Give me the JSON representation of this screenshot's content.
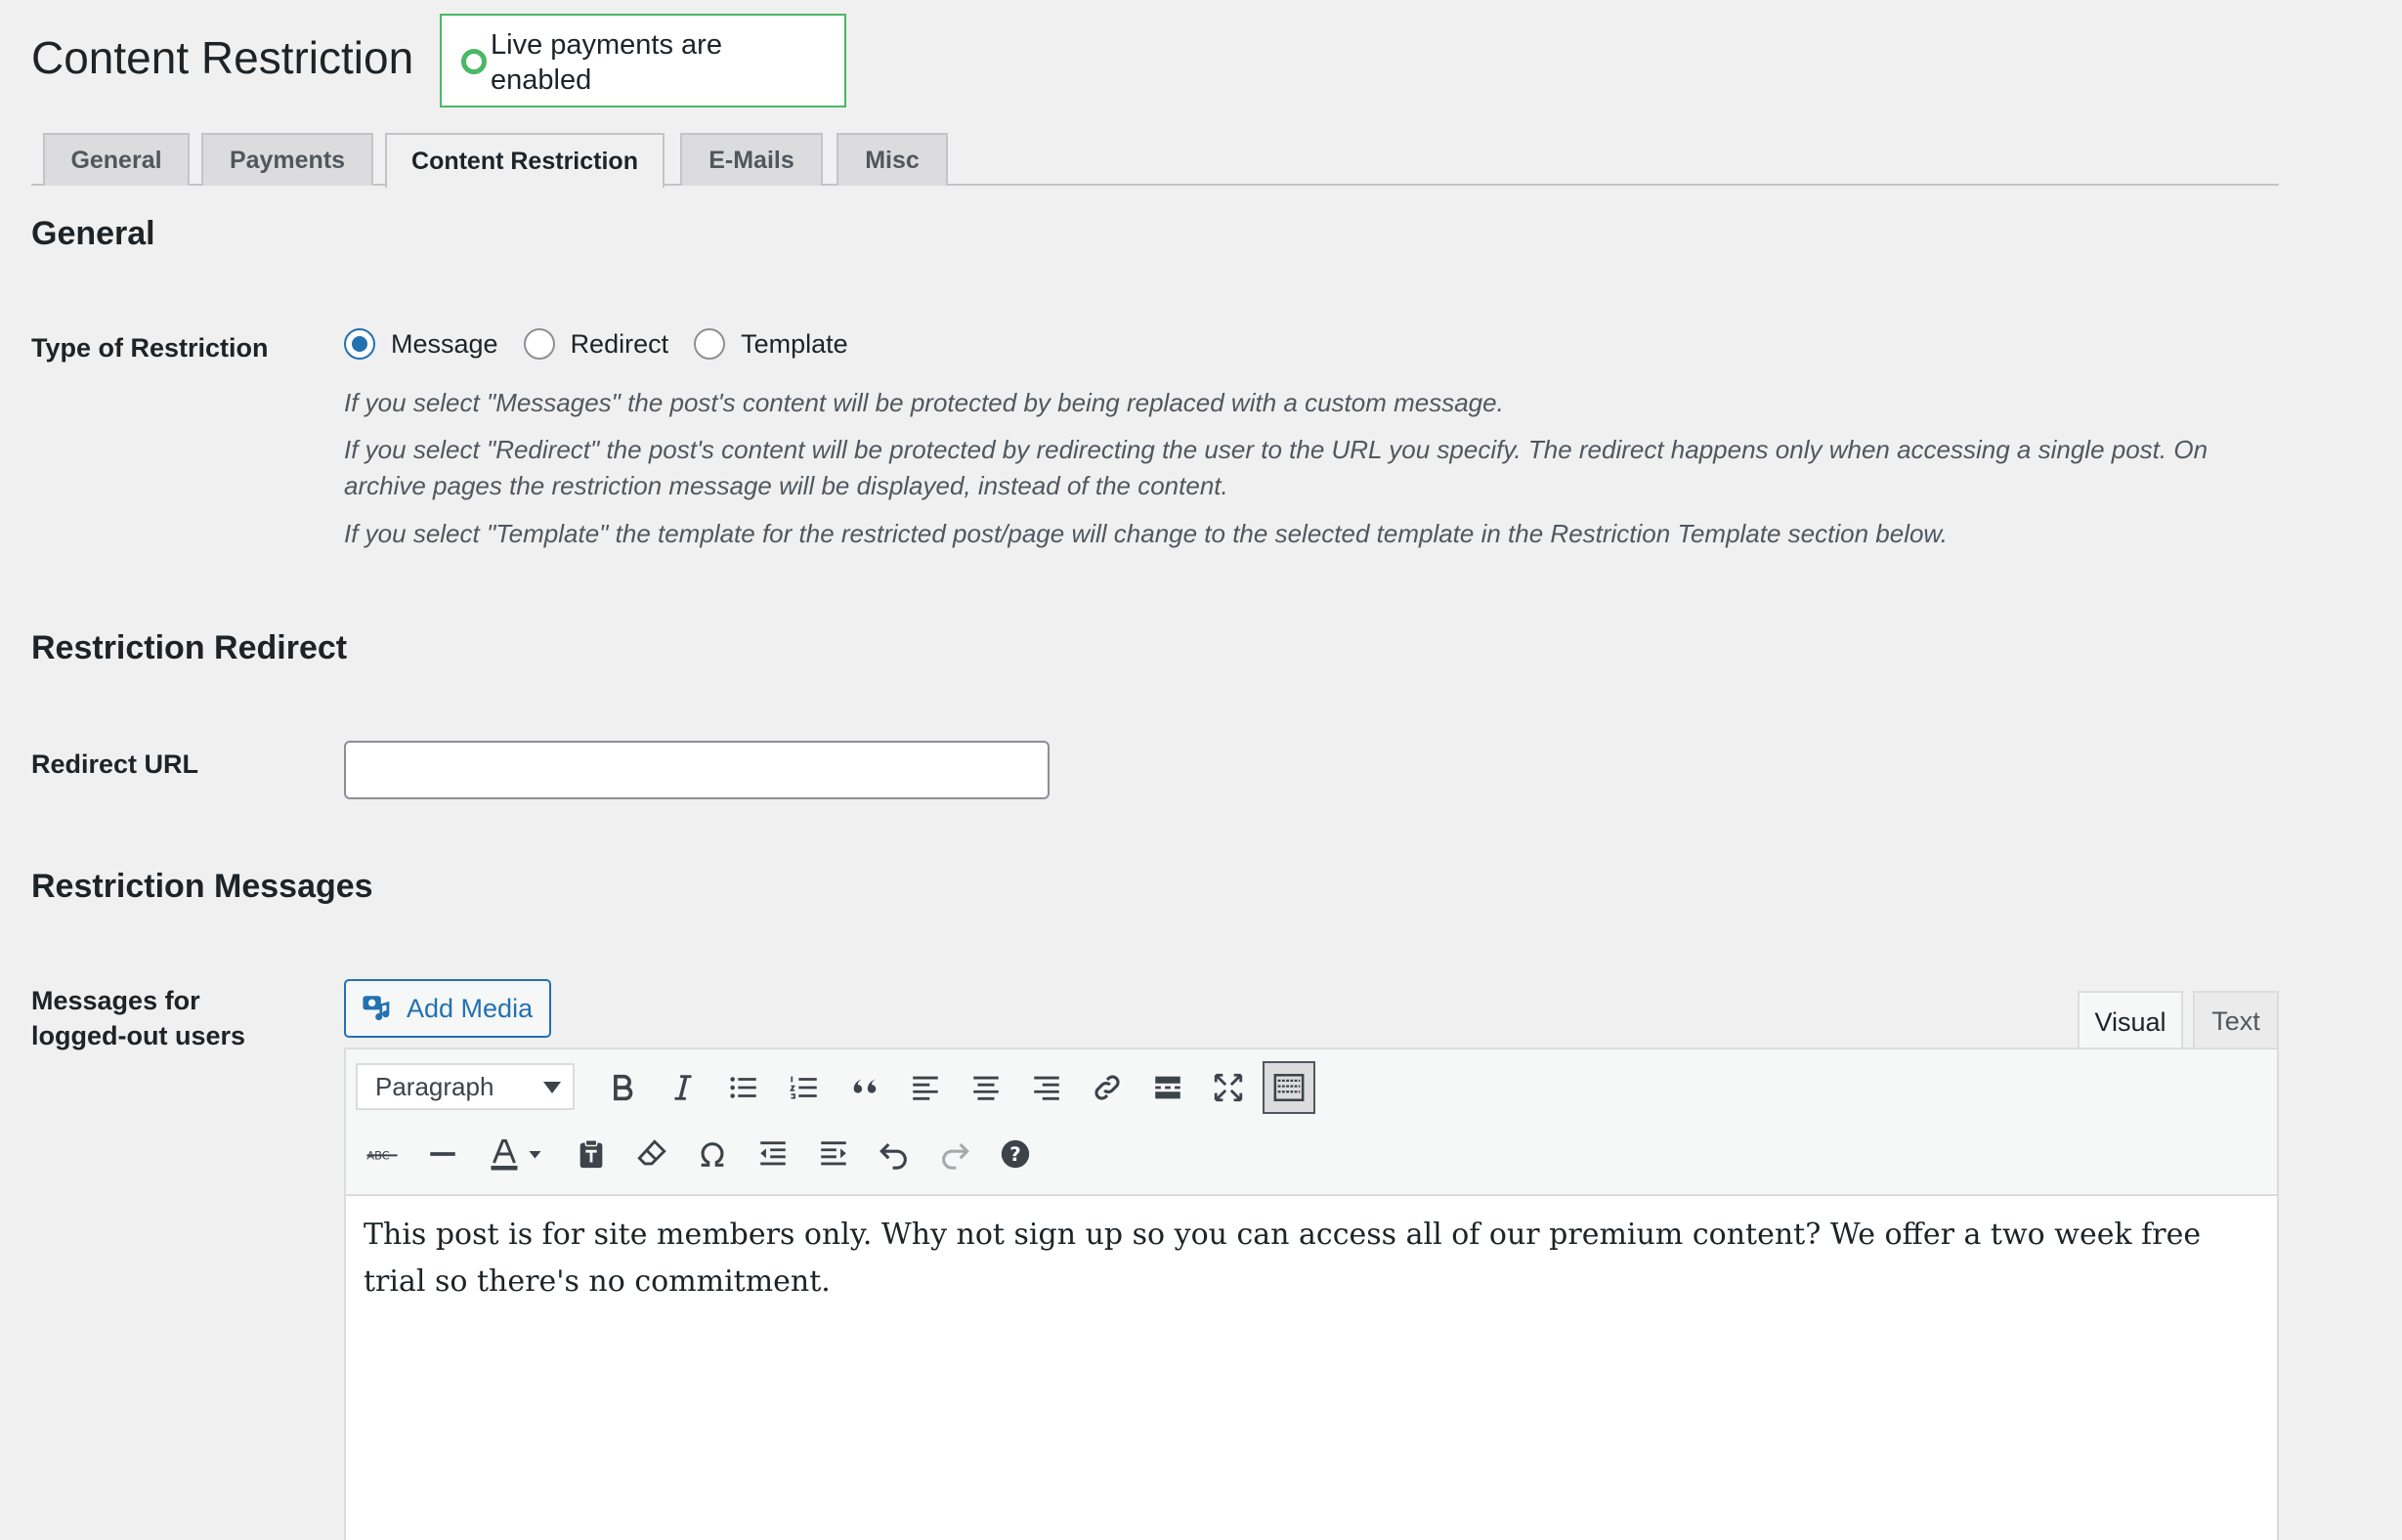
{
  "header": {
    "title": "Content Restriction",
    "notice": "Live payments are enabled",
    "notice_color": "#4ab866"
  },
  "tabs": [
    {
      "label": "General",
      "active": false
    },
    {
      "label": "Payments",
      "active": false
    },
    {
      "label": "Content Restriction",
      "active": true
    },
    {
      "label": "E-Mails",
      "active": false
    },
    {
      "label": "Misc",
      "active": false
    }
  ],
  "general": {
    "heading": "General",
    "type_label": "Type of Restriction",
    "options": [
      {
        "label": "Message",
        "checked": true
      },
      {
        "label": "Redirect",
        "checked": false
      },
      {
        "label": "Template",
        "checked": false
      }
    ],
    "descriptions": [
      "If you select \"Messages\" the post's content will be protected by being replaced with a custom message.",
      "If you select \"Redirect\" the post's content will be protected by redirecting the user to the URL you specify. The redirect happens only when accessing a single post. On archive pages the restriction message will be displayed, instead of the content.",
      "If you select \"Template\" the template for the restricted post/page will change to the selected template in the Restriction Template section below."
    ]
  },
  "redirect": {
    "heading": "Restriction Redirect",
    "url_label": "Redirect URL",
    "url_value": ""
  },
  "messages": {
    "heading": "Restriction Messages",
    "logged_out_label": "Messages for logged-out users",
    "add_media": "Add Media",
    "editor_tabs": {
      "visual": "Visual",
      "text": "Text"
    },
    "format": "Paragraph",
    "toolbar_row1": [
      "bold-icon",
      "italic-icon",
      "bulleted-list-icon",
      "numbered-list-icon",
      "blockquote-icon",
      "align-left-icon",
      "align-center-icon",
      "align-right-icon",
      "link-icon",
      "read-more-icon",
      "fullscreen-icon",
      "toolbar-toggle-icon"
    ],
    "toolbar_row2": [
      "strikethrough-icon",
      "horizontal-line-icon",
      "text-color-icon",
      "paste-text-icon",
      "clear-formatting-icon",
      "special-character-icon",
      "outdent-icon",
      "indent-icon",
      "undo-icon",
      "redo-icon",
      "help-icon"
    ],
    "content": "This post is for site members only. Why not sign up so you can access all of our premium content? We offer a two week free trial so there's no commitment."
  },
  "colors": {
    "accent": "#2271b1",
    "background": "#f0f0f1"
  }
}
